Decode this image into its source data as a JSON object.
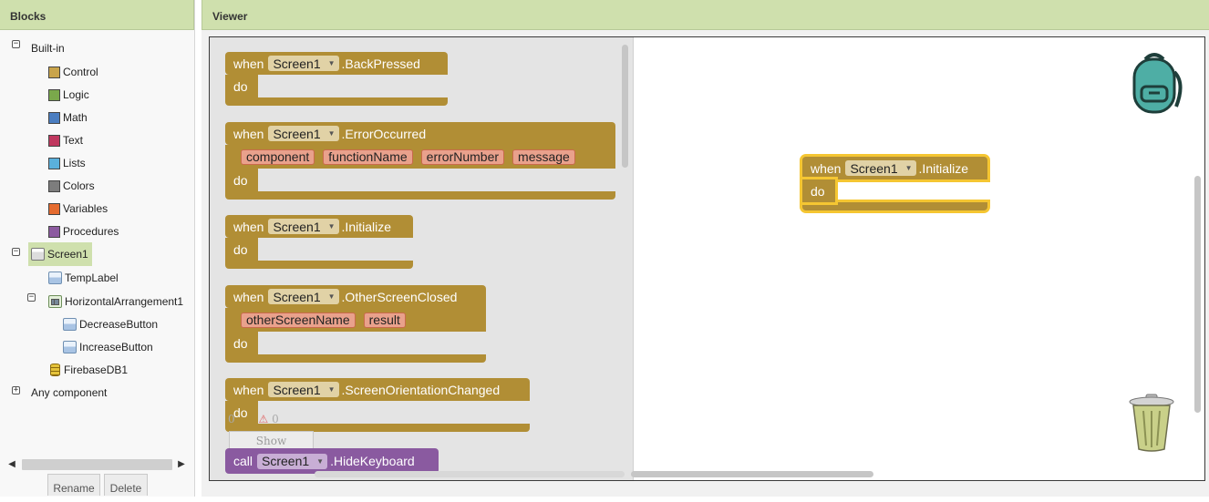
{
  "blocks_panel": {
    "title": "Blocks",
    "builtin": {
      "label": "Built-in",
      "toggle": "−",
      "items": [
        {
          "label": "Control",
          "color": "#c9a44b"
        },
        {
          "label": "Logic",
          "color": "#7aa84b"
        },
        {
          "label": "Math",
          "color": "#4a7dc0"
        },
        {
          "label": "Text",
          "color": "#c0385f"
        },
        {
          "label": "Lists",
          "color": "#5ab0dc"
        },
        {
          "label": "Colors",
          "color": "#7d7d7d"
        },
        {
          "label": "Variables",
          "color": "#e56b2f"
        },
        {
          "label": "Procedures",
          "color": "#8c5aa0"
        }
      ]
    },
    "screen": {
      "label": "Screen1",
      "toggle": "−",
      "components": [
        {
          "label": "TempLabel",
          "icon": "label-icon"
        },
        {
          "label": "HorizontalArrangement1",
          "icon": "horizontal-arrangement-icon",
          "toggle": "−",
          "children": [
            {
              "label": "DecreaseButton",
              "icon": "button-icon"
            },
            {
              "label": "IncreaseButton",
              "icon": "button-icon"
            }
          ]
        },
        {
          "label": "FirebaseDB1",
          "icon": "database-icon"
        }
      ]
    },
    "any_component": {
      "label": "Any component",
      "toggle": "+"
    },
    "buttons": {
      "rename": "Rename",
      "delete": "Delete"
    }
  },
  "viewer": {
    "title": "Viewer",
    "flyout_blocks": [
      {
        "kw": "when",
        "component": "Screen1",
        "event": ".BackPressed",
        "params": [],
        "do": "do"
      },
      {
        "kw": "when",
        "component": "Screen1",
        "event": ".ErrorOccurred",
        "params": [
          "component",
          "functionName",
          "errorNumber",
          "message"
        ],
        "do": "do"
      },
      {
        "kw": "when",
        "component": "Screen1",
        "event": ".Initialize",
        "params": [],
        "do": "do"
      },
      {
        "kw": "when",
        "component": "Screen1",
        "event": ".OtherScreenClosed",
        "params": [
          "otherScreenName",
          "result"
        ],
        "do": "do"
      },
      {
        "kw": "when",
        "component": "Screen1",
        "event": ".ScreenOrientationChanged",
        "params": [],
        "do": "do"
      }
    ],
    "call_block": {
      "kw": "call",
      "component": "Screen1",
      "method": ".HideKeyboard"
    },
    "workspace_block": {
      "kw": "when",
      "component": "Screen1",
      "event": ".Initialize",
      "do": "do"
    },
    "warnings": {
      "count_a": "0",
      "count_b": "0",
      "button": "Show Warnings"
    }
  },
  "colors": {
    "header": "#cfe0ad",
    "event_block": "#b18e35",
    "call_block": "#8a5aa0",
    "param": "#e9a18c",
    "selection": "#f5c632"
  }
}
